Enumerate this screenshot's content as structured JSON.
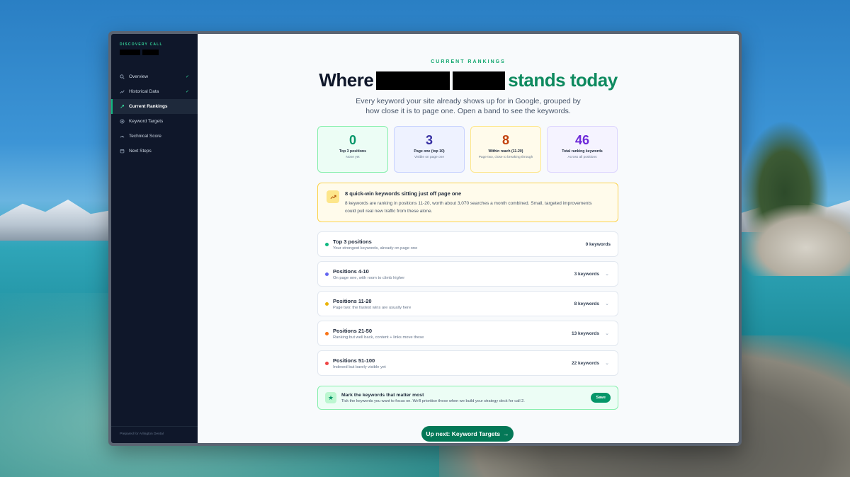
{
  "sidebar": {
    "eyebrow": "DISCOVERY CALL",
    "items": [
      {
        "label": "Overview",
        "icon": "search-icon",
        "done": true
      },
      {
        "label": "Historical Data",
        "icon": "trend-icon",
        "done": true
      },
      {
        "label": "Current Rankings",
        "icon": "link-icon",
        "done": false,
        "active": true
      },
      {
        "label": "Keyword Targets",
        "icon": "target-icon",
        "done": false
      },
      {
        "label": "Technical Score",
        "icon": "gauge-icon",
        "done": false
      },
      {
        "label": "Next Steps",
        "icon": "calendar-icon",
        "done": false
      }
    ],
    "check_glyph": "✓",
    "footer": "Prepared for Arlington Dental"
  },
  "header": {
    "eyebrow": "CURRENT RANKINGS",
    "headline_prefix": "Where",
    "headline_suffix": "stands today",
    "subhead": "Every keyword your site already shows up for in Google, grouped by how close it is to page one. Open a band to see the keywords."
  },
  "stats": [
    {
      "value": "0",
      "label": "Top 3 positions",
      "sub": "None yet"
    },
    {
      "value": "3",
      "label": "Page one (top 10)",
      "sub": "Visible on page one"
    },
    {
      "value": "8",
      "label": "Within reach (11-20)",
      "sub": "Page two, close to breaking through"
    },
    {
      "value": "46",
      "label": "Total ranking keywords",
      "sub": "Across all positions"
    }
  ],
  "callout": {
    "title": "8 quick-win keywords sitting just off page one",
    "body": "8 keywords are ranking in positions 11-20, worth about 3,070 searches a month combined. Small, targeted improvements could pull real new traffic from these alone."
  },
  "bands": [
    {
      "name": "Top 3 positions",
      "desc": "Your strongest keywords, already on page one",
      "count": "0 keywords",
      "color": "#10b981",
      "expandable": false
    },
    {
      "name": "Positions 4-10",
      "desc": "On page one, with room to climb higher",
      "count": "3 keywords",
      "color": "#6366f1",
      "expandable": true
    },
    {
      "name": "Positions 11-20",
      "desc": "Page two: the fastest wins are usually here",
      "count": "8 keywords",
      "color": "#eab308",
      "expandable": true
    },
    {
      "name": "Positions 21-50",
      "desc": "Ranking but well back, content + links move these",
      "count": "13 keywords",
      "color": "#f97316",
      "expandable": true
    },
    {
      "name": "Positions 51-100",
      "desc": "Indexed but barely visible yet",
      "count": "22 keywords",
      "color": "#ef4444",
      "expandable": true
    }
  ],
  "save_box": {
    "title": "Mark the keywords that matter most",
    "desc": "Tick the keywords you want to focus on. We'll prioritise these when we build your strategy deck for call 2.",
    "button": "Save",
    "icon": "star-icon"
  },
  "next_button": {
    "label": "Up next: Keyword Targets",
    "arrow": "→"
  },
  "colors": {
    "accent": "#0e8a5f",
    "sidebar_bg": "#0f172a",
    "main_bg": "#f8fafc"
  }
}
